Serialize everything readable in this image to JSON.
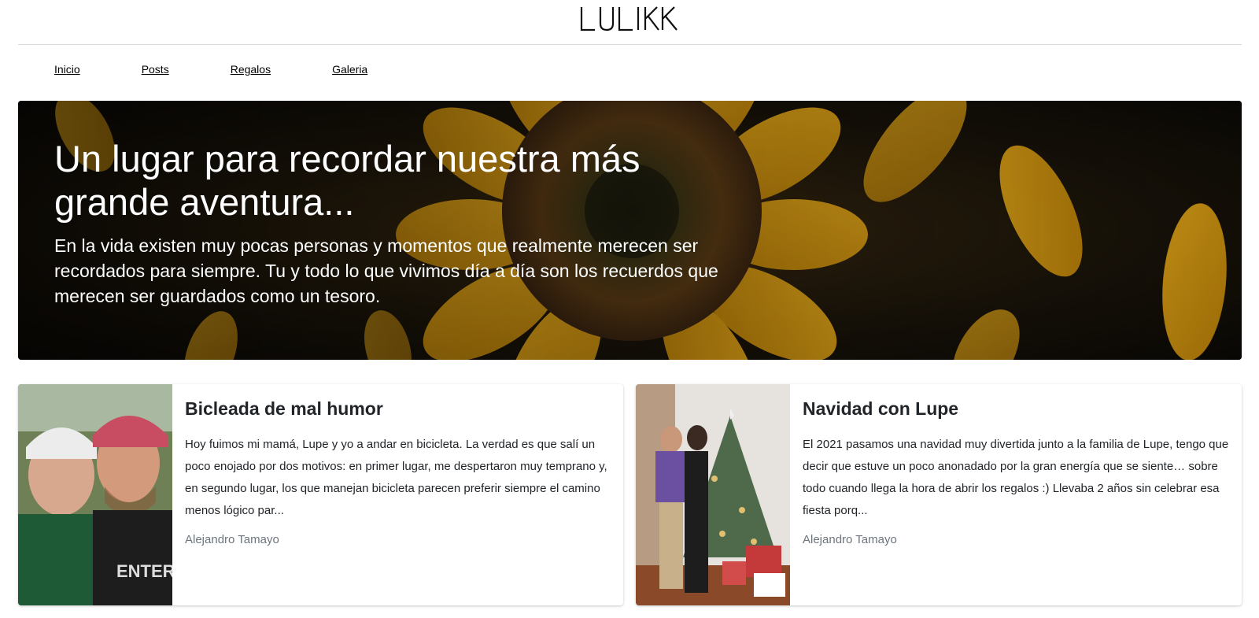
{
  "site": {
    "logo_text": "LULIKK"
  },
  "nav": [
    {
      "label": "Inicio"
    },
    {
      "label": "Posts"
    },
    {
      "label": "Regalos"
    },
    {
      "label": "Galeria"
    }
  ],
  "hero": {
    "title": "Un lugar para recordar nuestra más grande aventura...",
    "text": "En la vida existen muy pocas personas y momentos que realmente merecen ser recordados para siempre. Tu y todo lo que vivimos día a día son los recuerdos que merecen ser guardados como un tesoro."
  },
  "posts": [
    {
      "title": "Bicleada de mal humor",
      "excerpt": "Hoy fuimos mi mamá, Lupe y yo a andar en bicicleta. La verdad es que salí un poco enojado por dos motivos: en primer lugar, me despertaron muy temprano y, en segundo lugar, los que manejan bicicleta parecen preferir siempre el camino menos lógico par...",
      "author": "Alejandro Tamayo"
    },
    {
      "title": "Navidad con Lupe",
      "excerpt": "El 2021 pasamos una navidad muy divertida junto a la familia de Lupe, tengo que decir que estuve un poco anonadado por la gran energía que se siente… sobre todo cuando llega la hora de abrir los regalos :) Llevaba 2 años sin celebrar esa fiesta porq...",
      "author": "Alejandro Tamayo"
    }
  ]
}
